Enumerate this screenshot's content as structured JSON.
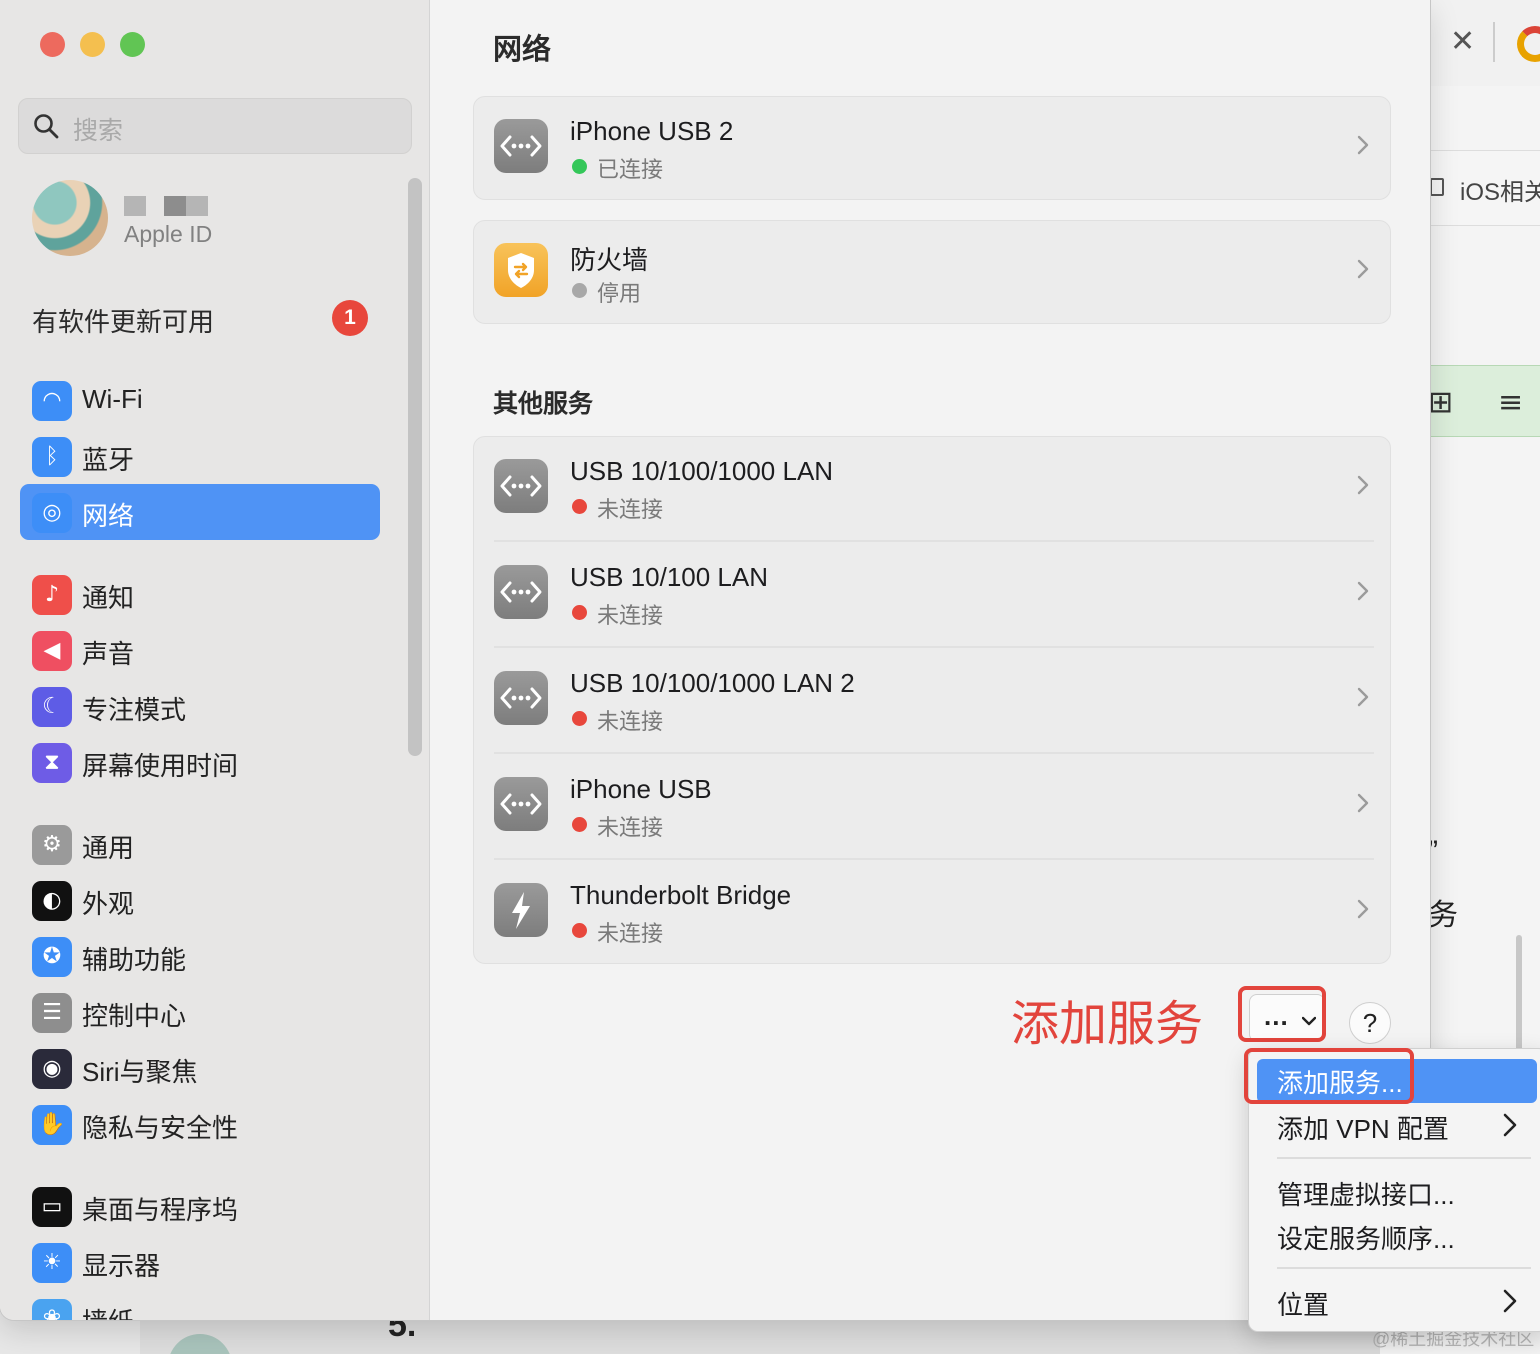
{
  "window": {
    "title": "网络",
    "search_placeholder": "搜索"
  },
  "profile": {
    "subtitle": "Apple ID"
  },
  "update": {
    "label": "有软件更新可用",
    "badge": "1"
  },
  "sidebar": {
    "items": [
      {
        "label": "Wi-Fi",
        "icon": "wifi-icon",
        "color": "#3d8ef7",
        "glyph": "◠",
        "active": false
      },
      {
        "label": "蓝牙",
        "icon": "bluetooth-icon",
        "color": "#3d8ef7",
        "glyph": "ᛒ",
        "active": false
      },
      {
        "label": "网络",
        "icon": "globe-icon",
        "color": "#3d8ef7",
        "glyph": "◎",
        "active": true
      },
      {
        "label": "通知",
        "icon": "bell-icon",
        "color": "#ef4f4a",
        "glyph": "♪",
        "active": false
      },
      {
        "label": "声音",
        "icon": "speaker-icon",
        "color": "#ef4f61",
        "glyph": "◀",
        "active": false
      },
      {
        "label": "专注模式",
        "icon": "moon-icon",
        "color": "#5e5ce6",
        "glyph": "☾",
        "active": false
      },
      {
        "label": "屏幕使用时间",
        "icon": "hourglass-icon",
        "color": "#6e5ce6",
        "glyph": "⧗",
        "active": false
      },
      {
        "label": "通用",
        "icon": "gear-icon",
        "color": "#9a9a9a",
        "glyph": "⚙",
        "active": false
      },
      {
        "label": "外观",
        "icon": "appearance-icon",
        "color": "#111111",
        "glyph": "◐",
        "active": false
      },
      {
        "label": "辅助功能",
        "icon": "accessibility-icon",
        "color": "#3d8ef7",
        "glyph": "✪",
        "active": false
      },
      {
        "label": "控制中心",
        "icon": "control-center-icon",
        "color": "#8e8e8e",
        "glyph": "☰",
        "active": false
      },
      {
        "label": "Siri与聚焦",
        "icon": "siri-icon",
        "color": "#2a2a3a",
        "glyph": "◉",
        "active": false
      },
      {
        "label": "隐私与安全性",
        "icon": "hand-icon",
        "color": "#3d8ef7",
        "glyph": "✋",
        "active": false
      },
      {
        "label": "桌面与程序坞",
        "icon": "dock-icon",
        "color": "#111111",
        "glyph": "▭",
        "active": false
      },
      {
        "label": "显示器",
        "icon": "brightness-icon",
        "color": "#3d8ef7",
        "glyph": "☀",
        "active": false
      },
      {
        "label": "墙纸",
        "icon": "wallpaper-icon",
        "color": "#4aa3f0",
        "glyph": "❀",
        "active": false
      }
    ]
  },
  "services": [
    {
      "title": "iPhone USB 2",
      "status": "已连接",
      "status_color": "#34c759",
      "icon": "network-adapter-icon"
    },
    {
      "title": "防火墙",
      "status": "停用",
      "status_color": "#a8a8a8",
      "icon": "firewall-icon"
    }
  ],
  "other_services": {
    "title": "其他服务",
    "items": [
      {
        "title": "USB 10/100/1000 LAN",
        "status": "未连接",
        "status_color": "#e8473c",
        "icon": "network-adapter-icon"
      },
      {
        "title": "USB 10/100 LAN",
        "status": "未连接",
        "status_color": "#e8473c",
        "icon": "network-adapter-icon"
      },
      {
        "title": "USB 10/100/1000 LAN 2",
        "status": "未连接",
        "status_color": "#e8473c",
        "icon": "network-adapter-icon"
      },
      {
        "title": "iPhone USB",
        "status": "未连接",
        "status_color": "#e8473c",
        "icon": "network-adapter-icon"
      },
      {
        "title": "Thunderbolt Bridge",
        "status": "未连接",
        "status_color": "#e8473c",
        "icon": "thunderbolt-icon"
      }
    ]
  },
  "actions": {
    "annotation": "添加服务",
    "more_label": "...",
    "help_label": "?"
  },
  "menu": {
    "items": [
      {
        "label": "添加服务...",
        "highlighted": true,
        "submenu": false
      },
      {
        "label": "添加 VPN 配置",
        "highlighted": false,
        "submenu": true
      },
      {
        "label": "管理虚拟接口...",
        "highlighted": false,
        "submenu": false
      },
      {
        "label": "设定服务顺序...",
        "highlighted": false,
        "submenu": false
      },
      {
        "label": "位置",
        "highlighted": false,
        "submenu": true
      }
    ]
  },
  "background_app": {
    "tab_label": "iOS相关",
    "text_1": "”",
    "text_2": "务",
    "bottom_text": "5.",
    "watermark": "@稀土掘金技术社区"
  }
}
